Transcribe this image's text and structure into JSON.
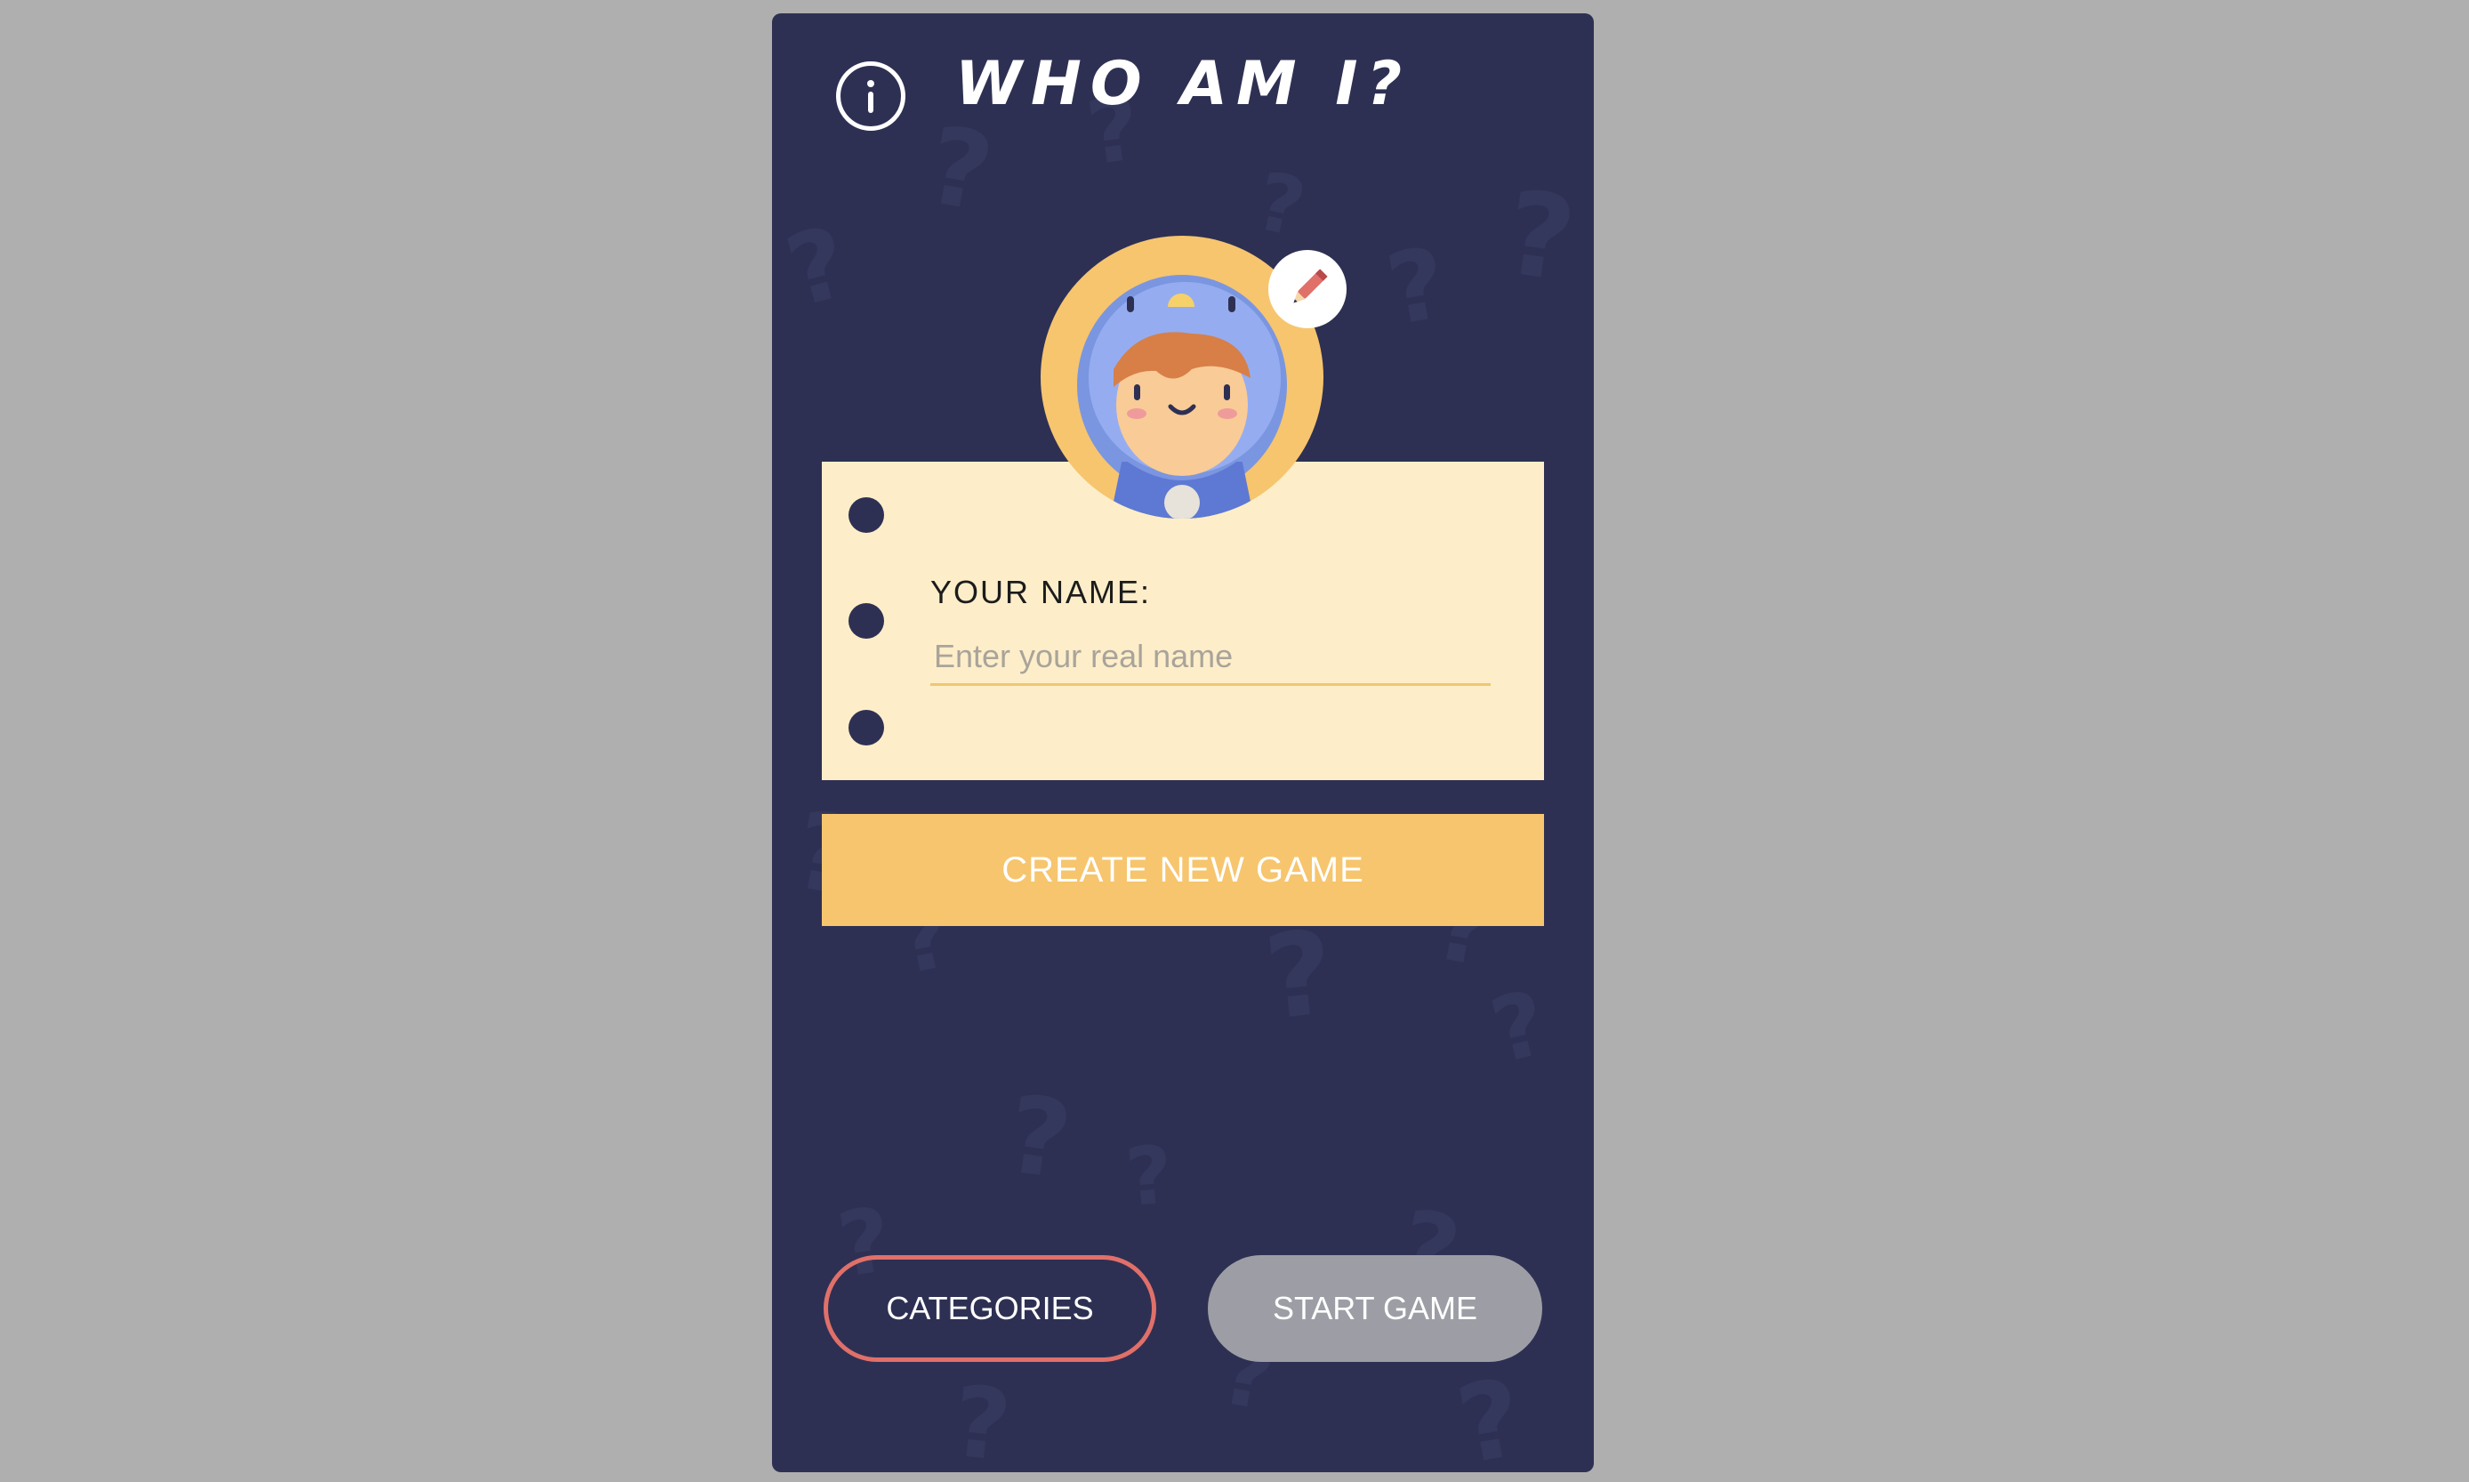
{
  "app": {
    "title": "WHO AM I?",
    "colors": {
      "background": "#2e3053",
      "card": "#fdeec9",
      "accent": "#f6c56e",
      "danger_outline": "#e0706a",
      "disabled": "#9d9ea5"
    }
  },
  "header": {
    "info_icon": "info-icon"
  },
  "avatar": {
    "icon": "avatar-character-icon",
    "edit_icon": "pencil-icon"
  },
  "name_card": {
    "label": "YOUR NAME:",
    "input_placeholder": "Enter your real name",
    "input_value": ""
  },
  "actions": {
    "create_label": "CREATE NEW GAME",
    "categories_label": "CATEGORIES",
    "start_label": "START GAME"
  }
}
